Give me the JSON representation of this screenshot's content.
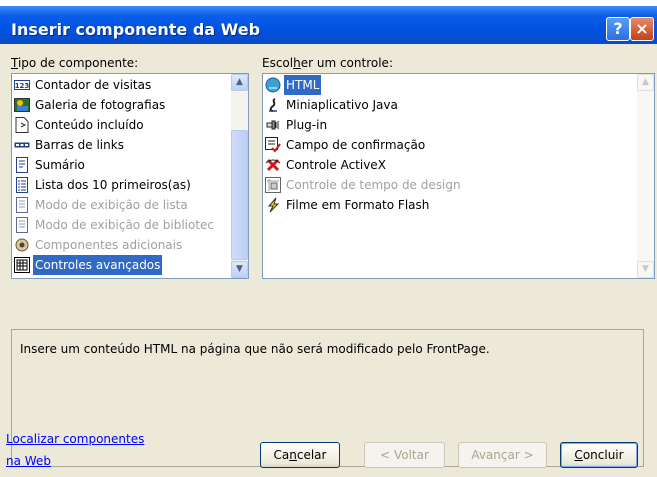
{
  "window": {
    "title": "Inserir componente da Web"
  },
  "titlebar_buttons": {
    "help": "?",
    "close": "×"
  },
  "left_list": {
    "label_prefix": "T",
    "label_rest": "ipo de componente:",
    "items": [
      {
        "label": "Contador de visitas",
        "icon": "counter-icon",
        "selected": false,
        "disabled": false
      },
      {
        "label": "Galeria de fotografias",
        "icon": "photo-gallery-icon",
        "selected": false,
        "disabled": false
      },
      {
        "label": "Conteúdo incluído",
        "icon": "included-content-icon",
        "selected": false,
        "disabled": false
      },
      {
        "label": "Barras de links",
        "icon": "link-bars-icon",
        "selected": false,
        "disabled": false
      },
      {
        "label": "Sumário",
        "icon": "summary-icon",
        "selected": false,
        "disabled": false
      },
      {
        "label": "Lista dos 10 primeiros(as)",
        "icon": "top10-list-icon",
        "selected": false,
        "disabled": false
      },
      {
        "label": "Modo de exibição de lista",
        "icon": "list-view-icon",
        "selected": false,
        "disabled": true
      },
      {
        "label": "Modo de exibição de bibliotec",
        "icon": "library-view-icon",
        "selected": false,
        "disabled": true
      },
      {
        "label": "Componentes adicionais",
        "icon": "additional-components-icon",
        "selected": false,
        "disabled": true
      },
      {
        "label": "Controles avançados",
        "icon": "advanced-controls-icon",
        "selected": true,
        "disabled": false
      }
    ]
  },
  "right_list": {
    "label_a": "Escol",
    "label_u": "h",
    "label_b": "er um controle:",
    "items": [
      {
        "label": "HTML",
        "icon": "html-icon",
        "selected": true,
        "disabled": false
      },
      {
        "label": "Miniaplicativo Java",
        "icon": "java-applet-icon",
        "selected": false,
        "disabled": false
      },
      {
        "label": "Plug-in",
        "icon": "plugin-icon",
        "selected": false,
        "disabled": false
      },
      {
        "label": "Campo de confirmação",
        "icon": "confirmation-field-icon",
        "selected": false,
        "disabled": false
      },
      {
        "label": "Controle ActiveX",
        "icon": "activex-icon",
        "selected": false,
        "disabled": false
      },
      {
        "label": "Controle de tempo de design",
        "icon": "design-time-control-icon",
        "selected": false,
        "disabled": true
      },
      {
        "label": "Filme em Formato Flash",
        "icon": "flash-movie-icon",
        "selected": false,
        "disabled": false
      }
    ]
  },
  "description": "Insere um conteúdo HTML na página que não será modificado pelo FrontPage.",
  "find_link": {
    "line1": "Localizar componentes",
    "line2": "na Web"
  },
  "buttons": {
    "cancel_a": "Ca",
    "cancel_u": "n",
    "cancel_b": "celar",
    "back": "< Voltar",
    "next": "Avançar >",
    "finish_u": "C",
    "finish_b": "oncluir"
  },
  "colors": {
    "title_bar": "#0052e2",
    "selection": "#316ac5",
    "dialog_bg": "#ece9d8",
    "link": "#0000ff"
  }
}
